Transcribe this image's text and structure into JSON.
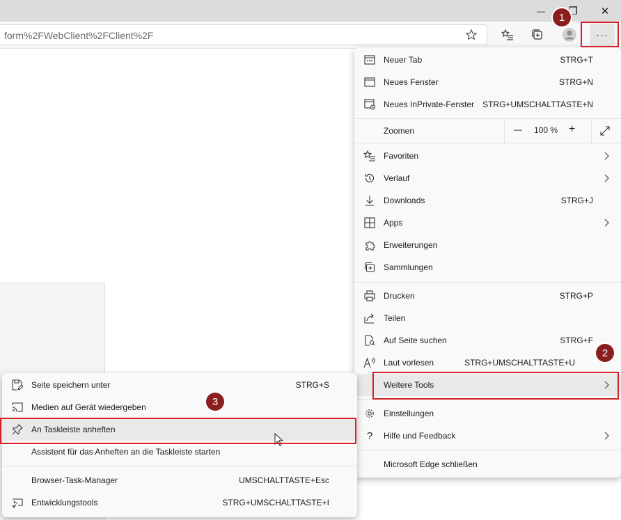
{
  "window": {
    "minimize": "—",
    "restore": "❐",
    "close": "✕"
  },
  "address_bar": {
    "url": "form%2FWebClient%2FClient%2F"
  },
  "toolbar": {
    "star_icon": "star-icon",
    "favorites_icon": "favorites-list-icon",
    "collections_icon": "collections-icon",
    "profile_icon": "profile-icon",
    "more_label": "···"
  },
  "main_menu": {
    "new_tab": {
      "label": "Neuer Tab",
      "shortcut": "STRG+T"
    },
    "new_window": {
      "label": "Neues Fenster",
      "shortcut": "STRG+N"
    },
    "new_inprivate": {
      "label": "Neues InPrivate-Fenster",
      "shortcut": "STRG+UMSCHALTTASTE+N"
    },
    "zoom": {
      "label": "Zoomen",
      "minus": "—",
      "value": "100 %",
      "plus": "+"
    },
    "favorites": {
      "label": "Favoriten"
    },
    "history": {
      "label": "Verlauf"
    },
    "downloads": {
      "label": "Downloads",
      "shortcut": "STRG+J"
    },
    "apps": {
      "label": "Apps"
    },
    "extensions": {
      "label": "Erweiterungen"
    },
    "collections": {
      "label": "Sammlungen"
    },
    "print": {
      "label": "Drucken",
      "shortcut": "STRG+P"
    },
    "share": {
      "label": "Teilen"
    },
    "find": {
      "label": "Auf Seite suchen",
      "shortcut": "STRG+F"
    },
    "read_aloud": {
      "label": "Laut vorlesen",
      "shortcut": "STRG+UMSCHALTTASTE+U"
    },
    "more_tools": {
      "label": "Weitere Tools"
    },
    "settings": {
      "label": "Einstellungen"
    },
    "help": {
      "label": "Hilfe und Feedback"
    },
    "close_edge": {
      "label": "Microsoft Edge schließen"
    }
  },
  "sub_menu": {
    "save_page": {
      "label": "Seite speichern unter",
      "shortcut": "STRG+S"
    },
    "cast": {
      "label": "Medien auf Gerät wiedergeben"
    },
    "pin_taskbar": {
      "label": "An Taskleiste anheften"
    },
    "pin_wizard": {
      "label": "Assistent für das Anheften an die Taskleiste starten"
    },
    "task_manager": {
      "label": "Browser-Task-Manager",
      "shortcut": "UMSCHALTTASTE+Esc"
    },
    "devtools": {
      "label": "Entwicklungstools",
      "shortcut": "STRG+UMSCHALTTASTE+I"
    }
  },
  "annotations": {
    "step1": "1",
    "step2": "2",
    "step3": "3"
  },
  "colors": {
    "highlight_red": "#d6202a",
    "badge": "#8a1e1e",
    "menu_bg": "#f9f9f9"
  }
}
